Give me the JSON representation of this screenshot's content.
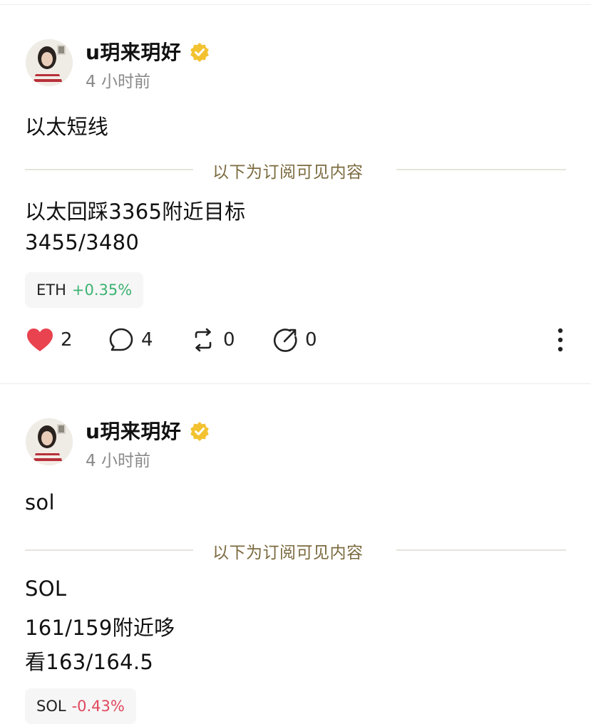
{
  "posts": [
    {
      "author": "u玥来玥好",
      "time": "4 小时前",
      "intro": "以太短线",
      "subscription_label": "以下为订阅可见内容",
      "content_lines": [
        "以太回踩3365附近目标",
        "3455/3480"
      ],
      "ticker": {
        "symbol": "ETH",
        "change": "+0.35%",
        "change_color": "#3cb371"
      },
      "actions": {
        "likes": "2",
        "comments": "4",
        "reposts": "0",
        "shares": "0"
      }
    },
    {
      "author": "u玥来玥好",
      "time": "4 小时前",
      "intro": "sol",
      "subscription_label": "以下为订阅可见内容",
      "content_lines": [
        "SOL",
        "161/159附近哆",
        "看163/164.5"
      ],
      "ticker": {
        "symbol": "SOL",
        "change": "-0.43%",
        "change_color": "#e0485e"
      }
    }
  ],
  "colors": {
    "verified_badge": "#f2c230",
    "like_heart": "#e8434f",
    "subscription_text": "#7c6b3f"
  },
  "icons": [
    "verified-badge-icon",
    "heart-icon",
    "comment-icon",
    "repost-icon",
    "share-icon",
    "more-vertical-icon"
  ]
}
